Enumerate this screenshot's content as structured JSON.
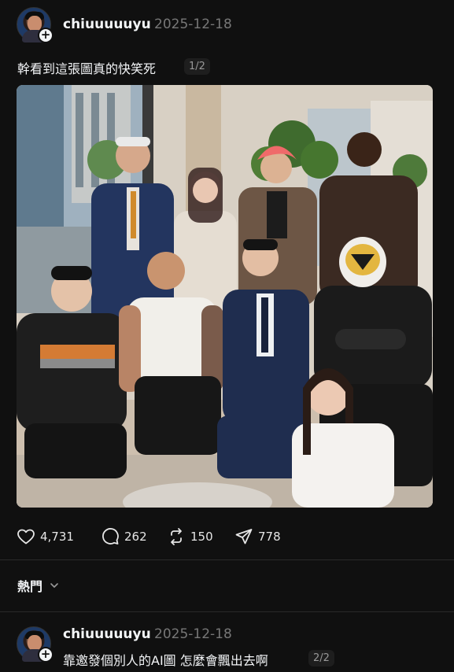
{
  "post1": {
    "username": "chiuuuuuyu",
    "date": "2025-12-18",
    "text": "幹看到這張圖真的快笑死",
    "pager": "1/2",
    "stats": {
      "likes": "4,731",
      "comments": "262",
      "reposts": "150",
      "shares": "778"
    }
  },
  "feed": {
    "sort_label": "熱門"
  },
  "post2": {
    "username": "chiuuuuuyu",
    "date": "2025-12-18",
    "text": "靠邀發個別人的AI圖 怎麼會飄出去啊",
    "pager": "2/2"
  },
  "icons": [
    "plus-icon",
    "heart-icon",
    "comment-icon",
    "repost-icon",
    "share-icon",
    "chevron-down-icon"
  ]
}
